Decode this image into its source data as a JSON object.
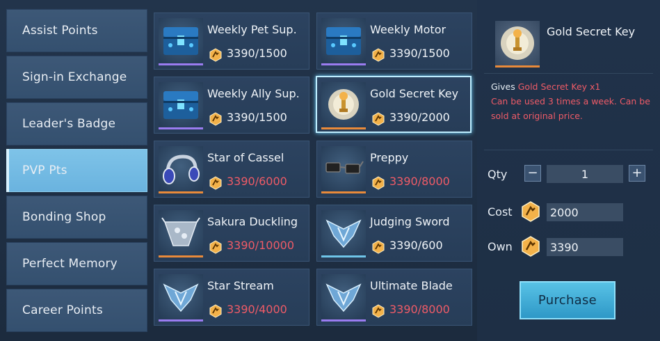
{
  "sidebar": {
    "items": [
      {
        "label": "Assist Points"
      },
      {
        "label": "Sign-in Exchange"
      },
      {
        "label": "Leader's Badge"
      },
      {
        "label": "PVP Pts"
      },
      {
        "label": "Bonding Shop"
      },
      {
        "label": "Perfect Memory"
      },
      {
        "label": "Career Points"
      }
    ],
    "active_index": 3
  },
  "items": [
    {
      "name": "Weekly Pet Sup.",
      "price": "3390/1500",
      "affordable": true,
      "icon": "blue-chest-icon",
      "rarity": "purple"
    },
    {
      "name": "Weekly Motor",
      "price": "3390/1500",
      "affordable": true,
      "icon": "blue-chest-icon",
      "rarity": "purple"
    },
    {
      "name": "Weekly Ally Sup.",
      "price": "3390/1500",
      "affordable": true,
      "icon": "blue-chest-icon",
      "rarity": "purple"
    },
    {
      "name": "Gold Secret Key",
      "price": "3390/2000",
      "affordable": true,
      "icon": "gold-key-icon",
      "rarity": "orange",
      "selected": true
    },
    {
      "name": "Star of Cassel",
      "price": "3390/6000",
      "affordable": false,
      "icon": "headphones-icon",
      "rarity": "orange"
    },
    {
      "name": "Preppy",
      "price": "3390/8000",
      "affordable": false,
      "icon": "glasses-icon",
      "rarity": "orange"
    },
    {
      "name": "Sakura Duckling",
      "price": "3390/10000",
      "affordable": false,
      "icon": "bandana-icon",
      "rarity": "orange"
    },
    {
      "name": "Judging Sword",
      "price": "3390/600",
      "affordable": true,
      "icon": "emblem-icon",
      "rarity": "blue"
    },
    {
      "name": "Star Stream",
      "price": "3390/4000",
      "affordable": false,
      "icon": "emblem-icon",
      "rarity": "purple"
    },
    {
      "name": "Ultimate Blade",
      "price": "3390/8000",
      "affordable": false,
      "icon": "emblem-icon",
      "rarity": "purple"
    }
  ],
  "detail": {
    "title": "Gold Secret Key",
    "gives_label": "Gives",
    "gives_item": "Gold Secret Key x1",
    "note": "Can be used 3 times a week. Can be sold at original price.",
    "qty_label": "Qty",
    "qty_value": "1",
    "minus": "−",
    "plus": "+",
    "cost_label": "Cost",
    "cost_value": "2000",
    "own_label": "Own",
    "own_value": "3390",
    "purchase_label": "Purchase"
  },
  "colors": {
    "accent": "#6ab3df",
    "price_red": "#ef5b67",
    "gold": "#f3b24a"
  }
}
